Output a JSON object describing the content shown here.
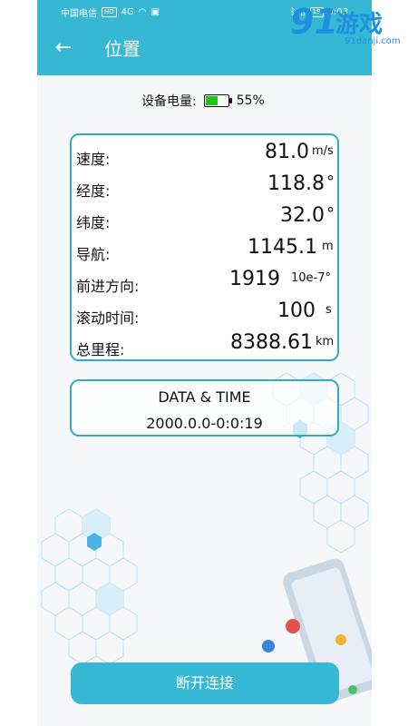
{
  "status_bar": {
    "carrier": "中国电信",
    "hd_badge": "HD",
    "network": "4G",
    "battery_percent_label": "19",
    "time": "5:03"
  },
  "header": {
    "title": "位置",
    "back_icon": "arrow-left-icon"
  },
  "device_battery": {
    "label": "设备电量:",
    "percent_text": "55%",
    "level": 0.55,
    "fill_color": "#22c41a"
  },
  "info": {
    "rows": [
      {
        "label": "速度:",
        "value": "81.0",
        "unit": "m/s"
      },
      {
        "label": "经度:",
        "value": "118.8",
        "unit": "°"
      },
      {
        "label": "纬度:",
        "value": "32.0",
        "unit": "°"
      },
      {
        "label": "导航:",
        "value": "1145.1",
        "unit": "m"
      },
      {
        "label": "前进方向:",
        "value": "1919",
        "unit": "10e-7°"
      },
      {
        "label": "滚动时间:",
        "value": "100",
        "unit": "s"
      },
      {
        "label": "总里程:",
        "value": "8388.61",
        "unit": "km"
      }
    ]
  },
  "datetime": {
    "title": "DATA & TIME",
    "value": "2000.0.0-0:0:19"
  },
  "actions": {
    "disconnect_label": "断开连接"
  },
  "watermark": {
    "number": "91",
    "text": "游戏",
    "url": "91danji.com"
  },
  "colors": {
    "accent": "#36b7d3",
    "card_border": "#37a9c7",
    "battery_green": "#22c41a"
  }
}
